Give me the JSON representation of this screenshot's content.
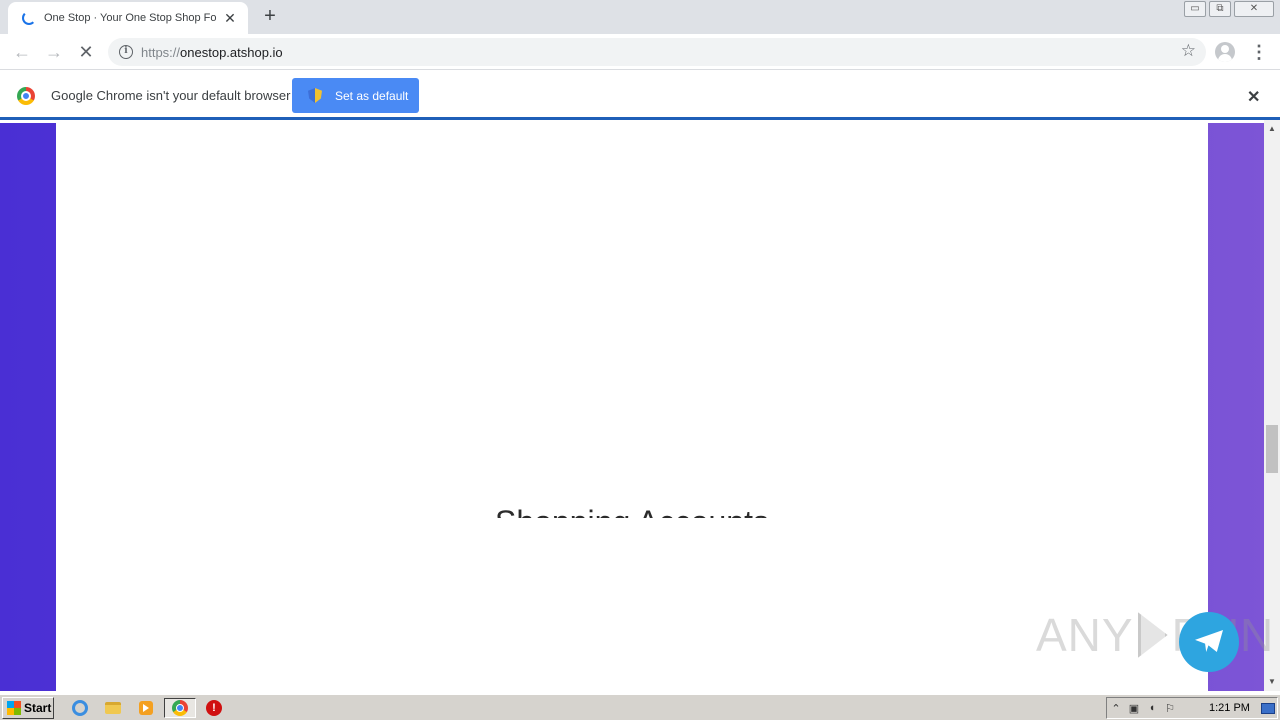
{
  "browser": {
    "tab": {
      "title": "One Stop · Your One Stop Shop For",
      "close_glyph": "✕"
    },
    "new_tab_glyph": "+",
    "window_controls": [
      "minimize-icon",
      "restore-icon",
      "close-icon"
    ],
    "toolbar": {
      "back_icon": "arrow-left-icon",
      "forward_icon": "arrow-right-icon",
      "stop_icon": "stop-loading-icon",
      "url_scheme": "https://",
      "url_host": "onestop.atshop.io"
    },
    "infobar": {
      "message": "Google Chrome isn't your default browser",
      "button_label": "Set as default",
      "close_glyph": "✕"
    }
  },
  "page": {
    "heading": "Shopping Accounts",
    "colors": {
      "gradient_start": "#4a2fd4",
      "gradient_end": "#7d55d6",
      "card": "#ffffff"
    }
  },
  "watermark": {
    "left_text": "ANY",
    "right_text": "RUN"
  },
  "taskbar": {
    "start_label": "Start",
    "apps": [
      "internet-explorer-icon",
      "folder-icon",
      "media-player-icon",
      "chrome-icon",
      "stop-sign-icon"
    ],
    "clock": "1:21 PM"
  }
}
